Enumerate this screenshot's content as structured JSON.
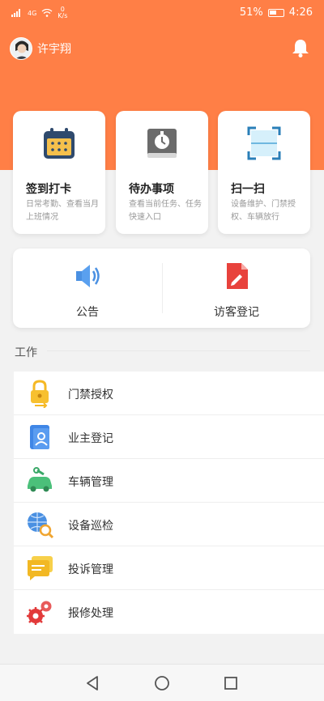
{
  "status": {
    "net_type": "4G",
    "speed_value": "0",
    "speed_unit": "K/s",
    "battery": "51%",
    "time": "4:26"
  },
  "header": {
    "user_name": "许宇翔",
    "accent": "#ff7f46"
  },
  "cards": [
    {
      "title": "签到打卡",
      "desc": "日常考勤、查看当月上班情况",
      "icon": "calendar-icon"
    },
    {
      "title": "待办事项",
      "desc": "查看当前任务、任务快速入口",
      "icon": "stopwatch-book-icon"
    },
    {
      "title": "扫一扫",
      "desc": "设备维护、门禁授权、车辆放行",
      "icon": "scan-icon"
    }
  ],
  "quick": [
    {
      "label": "公告",
      "icon": "speaker-icon"
    },
    {
      "label": "访客登记",
      "icon": "document-pen-icon"
    }
  ],
  "work": {
    "title": "工作",
    "items": [
      {
        "label": "门禁授权",
        "icon": "lock-icon"
      },
      {
        "label": "业主登记",
        "icon": "user-card-icon"
      },
      {
        "label": "车辆管理",
        "icon": "car-wrench-icon"
      },
      {
        "label": "设备巡检",
        "icon": "globe-search-icon"
      },
      {
        "label": "投诉管理",
        "icon": "chat-bubble-icon"
      },
      {
        "label": "报修处理",
        "icon": "gears-icon"
      }
    ]
  }
}
